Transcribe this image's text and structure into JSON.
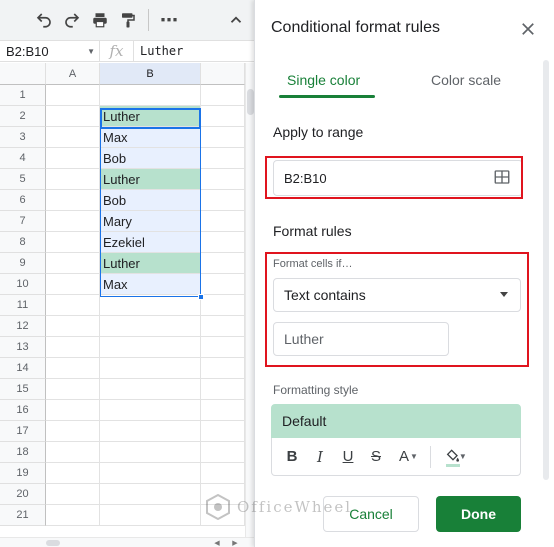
{
  "toolbar": {
    "icons": [
      "undo-icon",
      "redo-icon",
      "print-icon",
      "paint-format-icon",
      "more-icon",
      "collapse-icon"
    ],
    "more_label": "⋯"
  },
  "formula_bar": {
    "name_box": "B2:B10",
    "fx_label": "fx",
    "value": "Luther"
  },
  "sheet": {
    "columns": [
      "A",
      "B"
    ],
    "rows": [
      "1",
      "2",
      "3",
      "4",
      "5",
      "6",
      "7",
      "8",
      "9",
      "10",
      "11",
      "12",
      "13",
      "14",
      "15",
      "16",
      "17",
      "18",
      "19",
      "20",
      "21"
    ],
    "column_b": [
      "",
      "Luther",
      "Max",
      "Bob",
      "Luther",
      "Bob",
      "Mary",
      "Ezekiel",
      "Luther",
      "Max",
      "",
      "",
      "",
      "",
      "",
      "",
      "",
      "",
      "",
      "",
      ""
    ],
    "highlight_color": "#b7e1cd",
    "selection_color": "#e8f0fe"
  },
  "panel": {
    "title": "Conditional format rules",
    "tabs": [
      {
        "label": "Single color",
        "active": true
      },
      {
        "label": "Color scale",
        "active": false
      }
    ],
    "apply_to_range_label": "Apply to range",
    "range_value": "B2:B10",
    "format_rules_label": "Format rules",
    "format_cells_if_label": "Format cells if…",
    "condition_value": "Text contains",
    "condition_input_value": "Luther",
    "formatting_style_label": "Formatting style",
    "style_preview_label": "Default",
    "style_tools": {
      "bold": "B",
      "italic": "I",
      "underline": "U",
      "strike": "S",
      "text_color": "A"
    },
    "cancel_label": "Cancel",
    "done_label": "Done",
    "accent_color": "#188038",
    "annotation_color": "#e0141e"
  },
  "watermark": {
    "text": "OfficeWheel"
  }
}
